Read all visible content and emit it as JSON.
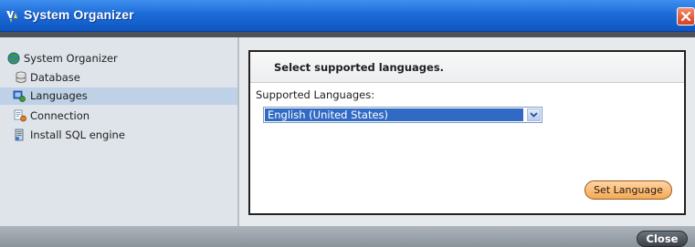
{
  "window": {
    "title": "System Organizer"
  },
  "sidebar": {
    "items": [
      {
        "label": "System Organizer",
        "icon": "globe-icon",
        "selected": false
      },
      {
        "label": "Database",
        "icon": "database-icon",
        "selected": false
      },
      {
        "label": "Languages",
        "icon": "languages-icon",
        "selected": true
      },
      {
        "label": "Connection",
        "icon": "connection-icon",
        "selected": false
      },
      {
        "label": "Install SQL engine",
        "icon": "install-icon",
        "selected": false
      }
    ]
  },
  "main": {
    "panel_title": "Select supported languages.",
    "field_label": "Supported Languages:",
    "language_select": {
      "selected": "English (United States)"
    },
    "set_language_label": "Set Language"
  },
  "footer": {
    "close_label": "Close"
  },
  "colors": {
    "title_bar": "#1c6cd8",
    "selection": "#316ac5",
    "set_language_button": "#f3a957"
  }
}
